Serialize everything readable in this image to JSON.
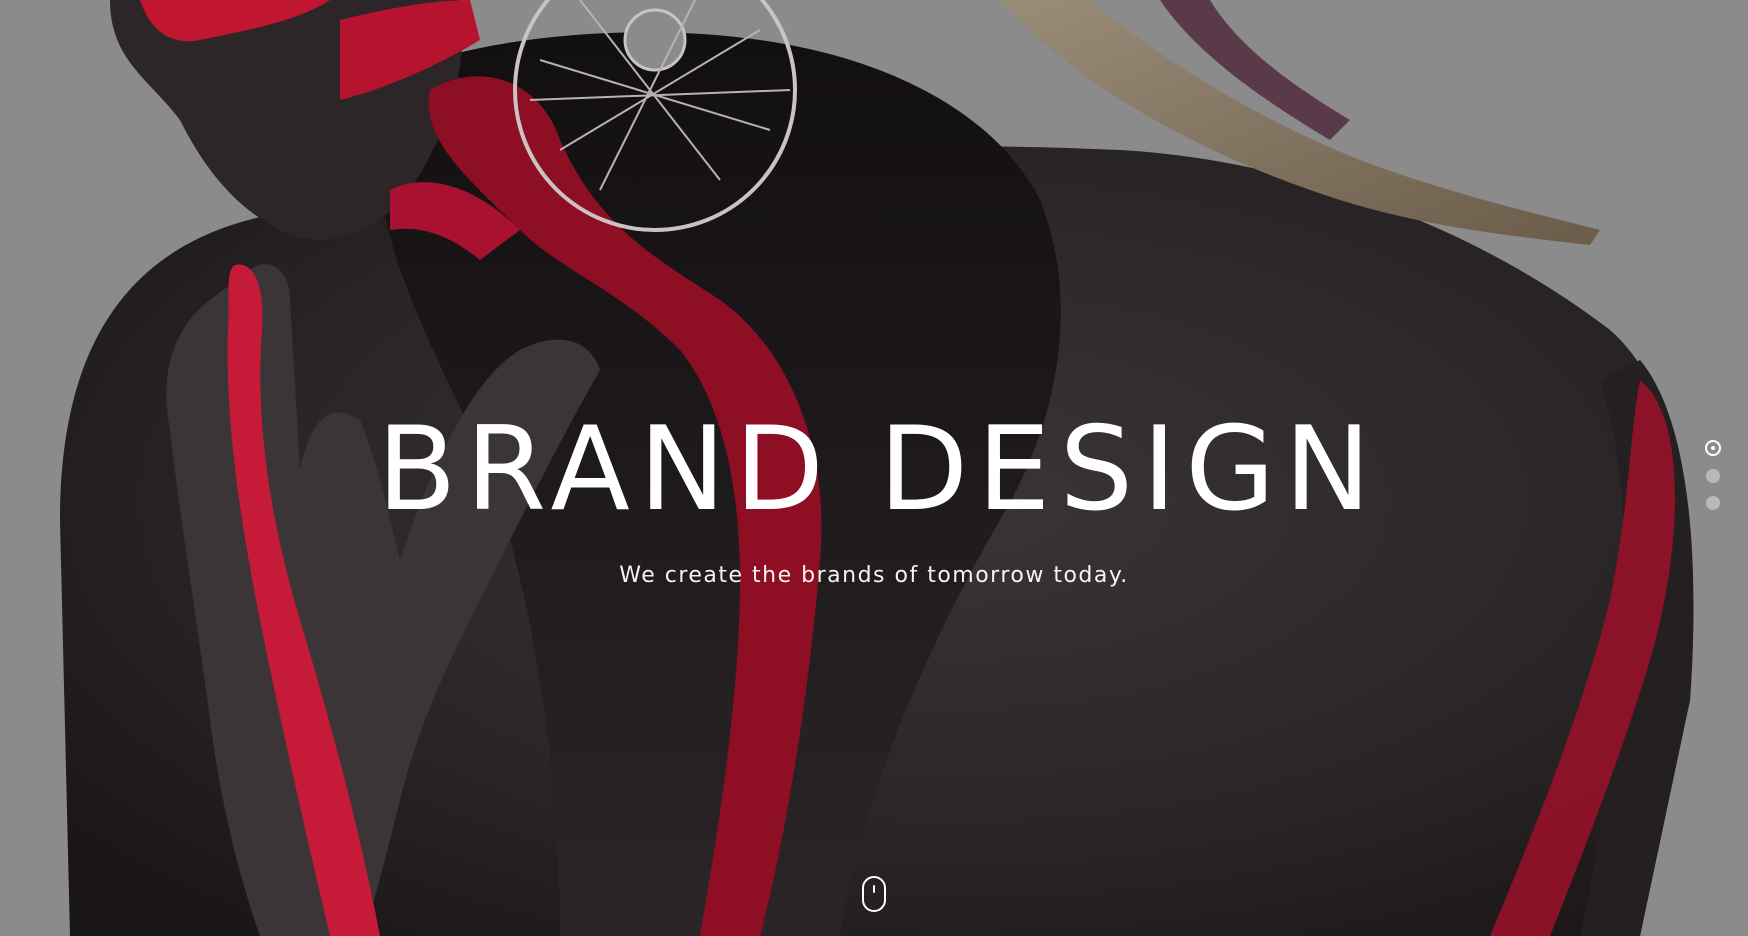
{
  "hero": {
    "title": "BRAND DESIGN",
    "subtitle": "We create the brands of tomorrow today."
  },
  "slider": {
    "slide_count": 3,
    "active_slide": 1
  },
  "colors": {
    "background_gray": "#8b8b8b",
    "skin_dark": "#2a2527",
    "paint_red": "#b0122c",
    "text": "#ffffff"
  },
  "icons": {
    "scroll": "mouse-scroll-icon"
  }
}
